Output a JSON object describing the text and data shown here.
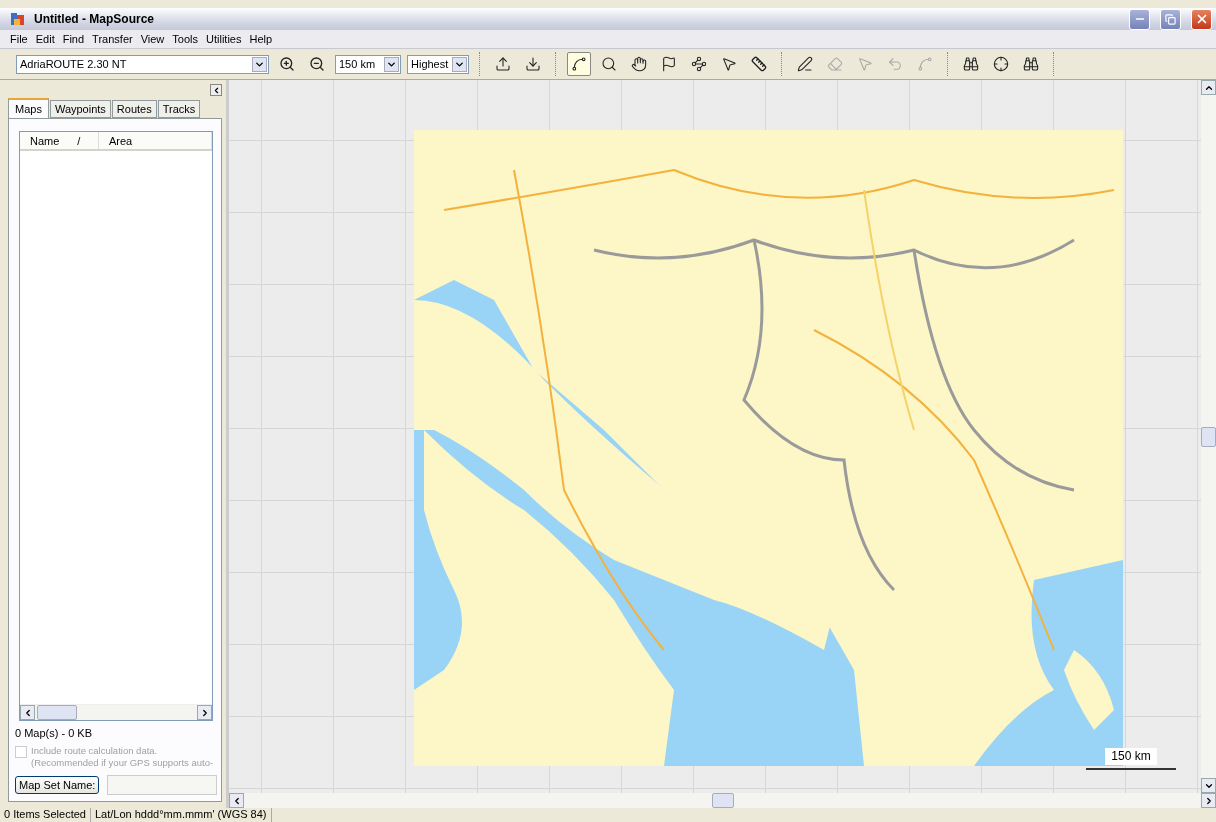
{
  "window": {
    "title": "Untitled - MapSource"
  },
  "menu": [
    "File",
    "Edit",
    "Find",
    "Transfer",
    "View",
    "Tools",
    "Utilities",
    "Help"
  ],
  "toolbar": {
    "map_product": "AdriaROUTE 2.30 NT",
    "zoom_scale": "150 km",
    "detail": "Highest"
  },
  "tool_groups": [
    {
      "tools": [
        {
          "kind": "send",
          "disabled": false
        },
        {
          "kind": "receive",
          "disabled": false
        }
      ]
    },
    {
      "tools": [
        {
          "kind": "map-select",
          "selected": true,
          "disabled": false
        },
        {
          "kind": "zoom",
          "selected": false,
          "disabled": false
        },
        {
          "kind": "hand",
          "selected": false,
          "disabled": false
        },
        {
          "kind": "flag",
          "selected": false,
          "disabled": false
        },
        {
          "kind": "route",
          "selected": false,
          "disabled": false
        },
        {
          "kind": "pointer",
          "selected": false,
          "disabled": false
        },
        {
          "kind": "ruler",
          "selected": false,
          "disabled": false
        }
      ]
    },
    {
      "tools": [
        {
          "kind": "pencil",
          "disabled": false
        },
        {
          "kind": "eraser",
          "disabled": true
        },
        {
          "kind": "select-track",
          "disabled": true
        },
        {
          "kind": "join-track",
          "disabled": true
        },
        {
          "kind": "divide-track",
          "disabled": true
        }
      ]
    },
    {
      "tools": [
        {
          "kind": "find",
          "disabled": false
        },
        {
          "kind": "find-near",
          "disabled": false
        },
        {
          "kind": "find-recent",
          "disabled": false
        }
      ]
    }
  ],
  "left_panel": {
    "tabs": [
      {
        "label": "Maps",
        "selected": true
      },
      {
        "label": "Waypoints",
        "selected": false
      },
      {
        "label": "Routes",
        "selected": false
      },
      {
        "label": "Tracks",
        "selected": false
      }
    ],
    "columns": [
      {
        "label": "Name",
        "sort": "/"
      },
      {
        "label": "Area"
      }
    ],
    "summary": "0 Map(s) - 0 KB",
    "include_route": {
      "label": "Include route calculation data.",
      "note": "(Recommended if your GPS supports auto-",
      "checked": false,
      "disabled": true
    },
    "map_set_button": "Map Set Name:"
  },
  "map": {
    "scale": "150 km"
  },
  "status_bar": [
    "0 Items Selected",
    "Lat/Lon hddd°mm.mmm' (WGS 84)"
  ]
}
